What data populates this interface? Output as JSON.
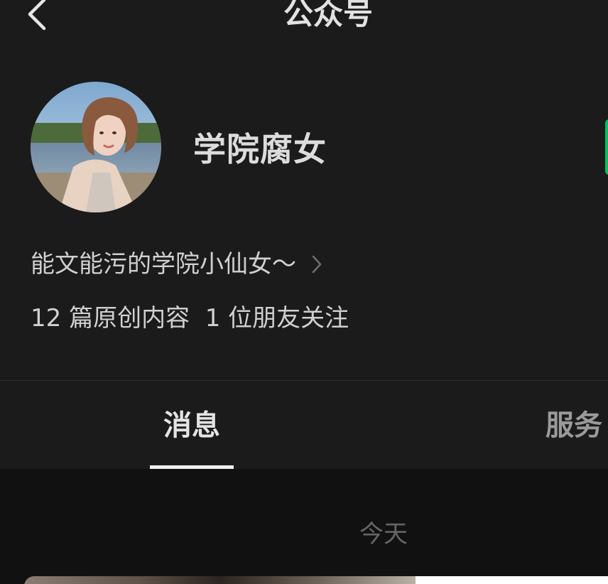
{
  "header": {
    "title": "公众号",
    "back_icon": "chevron-left-icon"
  },
  "profile": {
    "name": "学院腐女",
    "bio": "能文能污的学院小仙女～",
    "bio_icon": "chevron-right-icon",
    "stats": {
      "original": "12 篇原创内容",
      "followers": "1 位朋友关注"
    }
  },
  "tabs": [
    {
      "label": "消息",
      "active": true
    },
    {
      "label": "服务",
      "active": false
    }
  ],
  "messages": {
    "date_label": "今天"
  },
  "colors": {
    "background": "#1b1b1b",
    "message_background": "#111111",
    "accent_green": "#07c160"
  }
}
